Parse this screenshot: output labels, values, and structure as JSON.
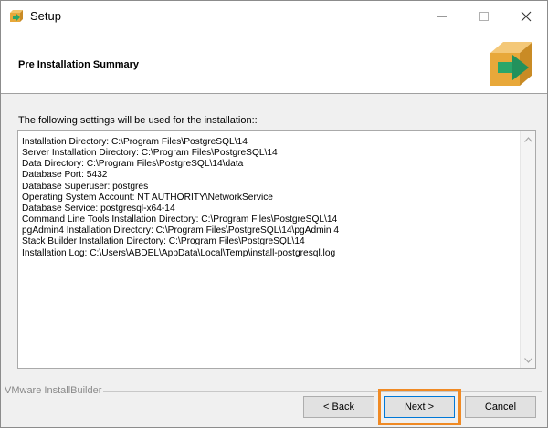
{
  "window": {
    "title": "Setup",
    "icon": "installer-box-icon",
    "controls": {
      "minimize": "minimize-icon",
      "maximize": "maximize-icon",
      "close": "close-icon"
    }
  },
  "header": {
    "title": "Pre Installation Summary",
    "logo": "installer-box-arrow-icon"
  },
  "main": {
    "intro": "The following settings will be used for the installation::",
    "summary_lines": [
      "Installation Directory: C:\\Program Files\\PostgreSQL\\14",
      "Server Installation Directory: C:\\Program Files\\PostgreSQL\\14",
      "Data Directory: C:\\Program Files\\PostgreSQL\\14\\data",
      "Database Port: 5432",
      "Database Superuser: postgres",
      "Operating System Account: NT AUTHORITY\\NetworkService",
      "Database Service: postgresql-x64-14",
      "Command Line Tools Installation Directory: C:\\Program Files\\PostgreSQL\\14",
      "pgAdmin4 Installation Directory: C:\\Program Files\\PostgreSQL\\14\\pgAdmin 4",
      "Stack Builder Installation Directory: C:\\Program Files\\PostgreSQL\\14",
      "Installation Log: C:\\Users\\ABDEL\\AppData\\Local\\Temp\\install-postgresql.log"
    ]
  },
  "footer": {
    "brand": "VMware InstallBuilder",
    "back_label": "< Back",
    "next_label": "Next >",
    "cancel_label": "Cancel"
  },
  "colors": {
    "highlight": "#f08a24",
    "logo_box": "#e8a83a",
    "logo_arrow": "#2aa66a",
    "default_button_border": "#0078d7"
  }
}
